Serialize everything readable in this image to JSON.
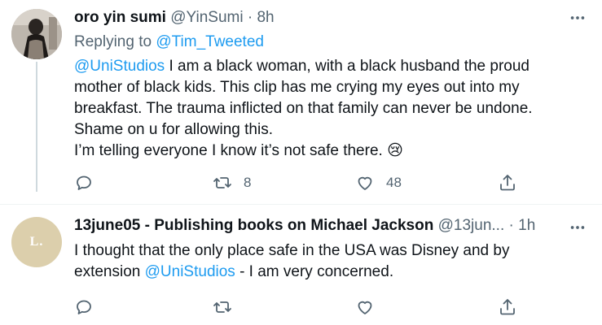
{
  "tweets": [
    {
      "name": "oro yin sumi",
      "handle": "@YinSumi",
      "separator": "·",
      "time": "8h",
      "replying_prefix": "Replying to ",
      "replying_handle": "@Tim_Tweeted",
      "mention": "@UniStudios",
      "text_after_mention": " I am a black woman, with a black husband the proud mother of black kids. This clip has me crying my eyes out into my breakfast. The trauma inflicted on that family can never be undone. Shame on u for allowing this.",
      "text_line2": "I’m telling everyone I know it’s not safe there. 😢",
      "retweets": "8",
      "likes": "48"
    },
    {
      "name": "13june05 - Publishing books on Michael Jackson",
      "handle": "@13jun...",
      "separator": "·",
      "time": "1h",
      "avatar_text": "L.",
      "text_before_mention": "I thought that the only place safe in the USA was Disney and by extension ",
      "mention": "@UniStudios",
      "text_after_mention": " - I am very concerned."
    }
  ],
  "icons": {
    "more": "more-horizontal-icon",
    "reply": "reply-icon",
    "retweet": "retweet-icon",
    "like": "heart-icon",
    "share": "share-icon"
  },
  "colors": {
    "link": "#1d9bf0",
    "secondary_text": "#536471",
    "primary_text": "#0f1419"
  }
}
